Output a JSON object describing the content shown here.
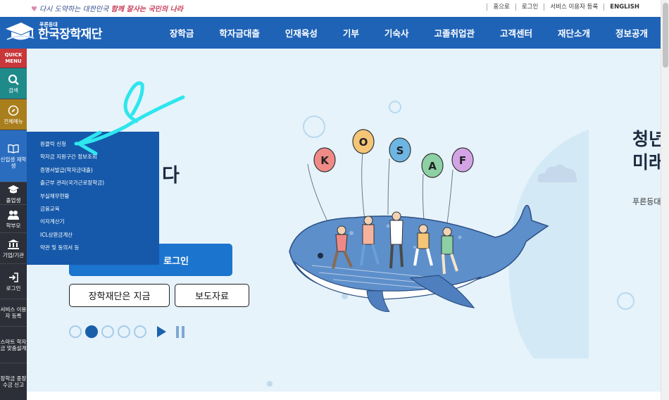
{
  "topbar": {
    "slogan_pre": "다시 도약하는 대한민국",
    "slogan_em": "함께 잘사는 국민의 나라",
    "links": [
      "홈으로",
      "로그인",
      "서비스 이용자 등록",
      "ENGLISH"
    ]
  },
  "brand": {
    "small": "푸른등대",
    "name": "한국장학재단"
  },
  "nav": {
    "items": [
      "장학금",
      "학자금대출",
      "인재육성",
      "기부",
      "기숙사",
      "고졸취업관",
      "고객센터",
      "재단소개",
      "정보공개"
    ]
  },
  "quickbar": {
    "quick_menu": "QUICK MENU",
    "search": "검색",
    "all_menu": "전체메뉴",
    "freshman": "신입생 재학생",
    "graduate": "졸업생",
    "parent": "학부모",
    "corp": "기업/기관",
    "login": "로그인",
    "service": "서비스 이용자 등록",
    "smart": "스마트 학자금 맞춤설계",
    "report": "장학금 중장수금 신고"
  },
  "submenu": {
    "items": [
      "원클릭 신청",
      "학자금 지원구간 정보조회",
      "증명서발급(학자금대출)",
      "출근부 관리(국가근로장학금)",
      "부실채무현황",
      "금융교육",
      "이자계산기",
      "ICL상환금계산",
      "약관 및 동의서 등"
    ]
  },
  "hero": {
    "title_fragment": "다",
    "login_label": "로그인",
    "button_1": "장학재단은 지금",
    "button_2": "보도자료",
    "balloon_letters": [
      "K",
      "O",
      "S",
      "A",
      "F"
    ],
    "right_title_1": "청년",
    "right_title_2": "미래",
    "right_sub": "푸른등대"
  },
  "colors": {
    "nav_blue": "#1f63b7",
    "hero_bg": "#e6f3fb",
    "login_blue": "#1b74cd",
    "arrow_cyan": "#2ee6ee"
  }
}
